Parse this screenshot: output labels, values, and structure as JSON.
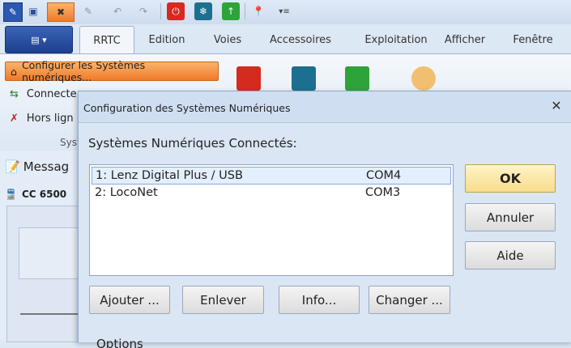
{
  "ribbon": {
    "tabs": [
      "RRTC",
      "Edition",
      "Voies",
      "Accessoires",
      "Exploitation",
      "Afficher",
      "Fenêtre"
    ],
    "active_tab": "RRTC",
    "configure_label": "Configurer les Systèmes numériques...",
    "connect_label": "Connecte",
    "offline_label": "Hors lign",
    "group_label": "Syst"
  },
  "left_panel": {
    "message_label": "Messag",
    "loco_label": "CC 6500"
  },
  "dialog": {
    "title": "Configuration des Systèmes Numériques",
    "section_label": "Systèmes Numériques Connectés:",
    "systems": [
      {
        "name": "1: Lenz Digital Plus / USB",
        "port": "COM4",
        "selected": true
      },
      {
        "name": "2: LocoNet",
        "port": "COM3",
        "selected": false
      }
    ],
    "buttons": {
      "ok": "OK",
      "cancel": "Annuler",
      "help": "Aide",
      "add": "Ajouter ...",
      "remove": "Enlever",
      "info": "Info...",
      "change": "Changer ..."
    },
    "options_label": "Options"
  },
  "colors": {
    "highlight": "#ef7a2a",
    "accent_blue": "#1d3f8e",
    "ok_button": "#f7dc8a"
  }
}
